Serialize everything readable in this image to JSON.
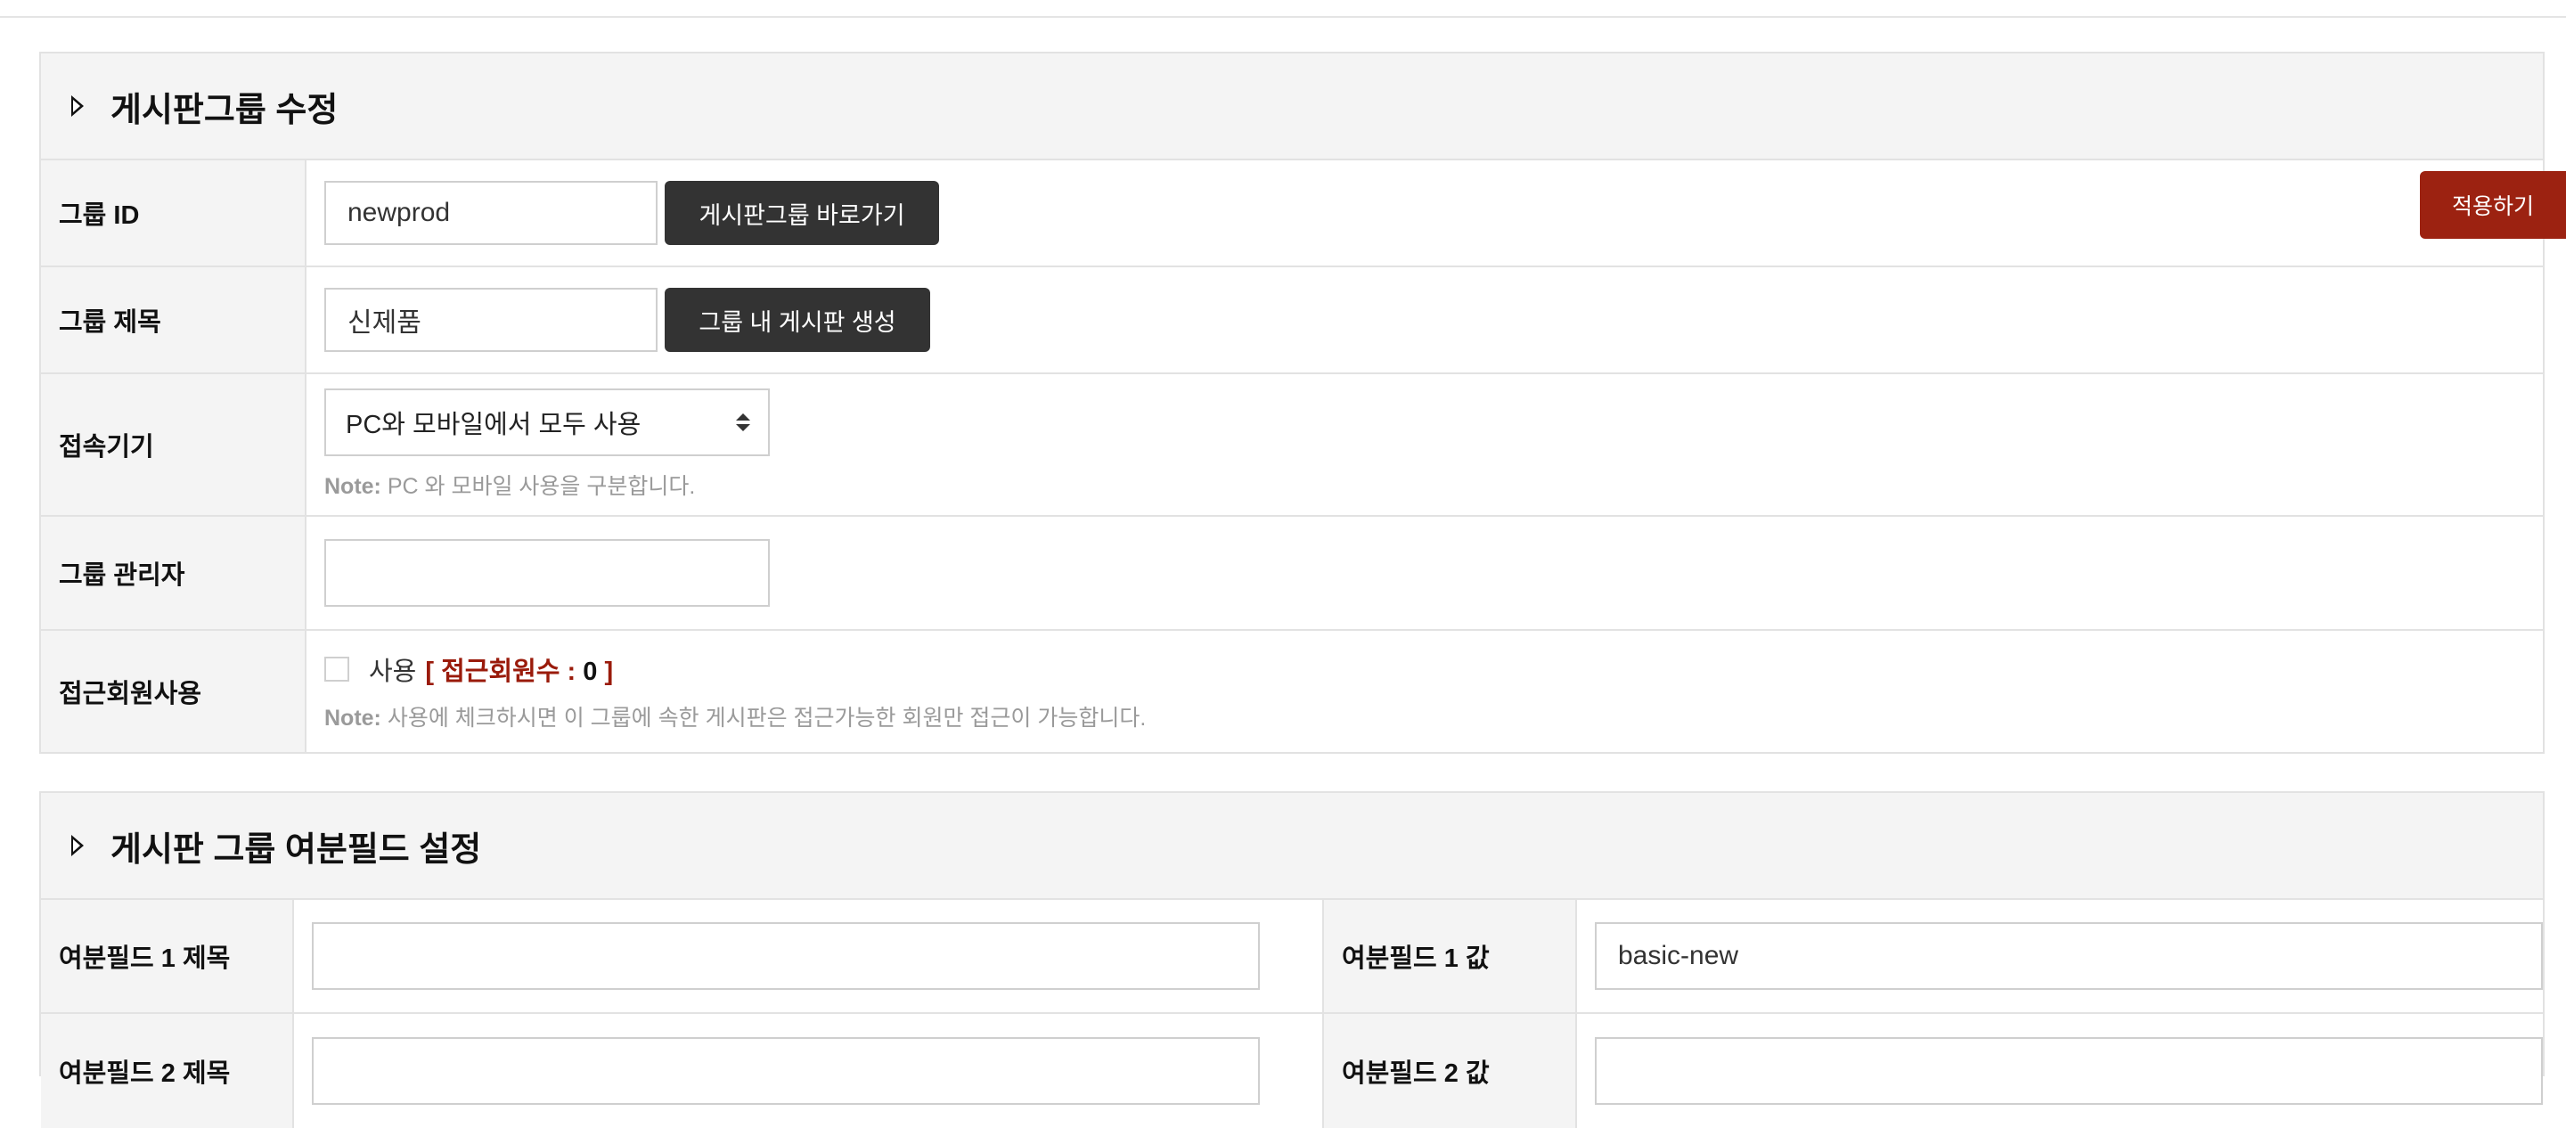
{
  "group_edit": {
    "title": "게시판그룹 수정",
    "group_id": {
      "label": "그룹 ID",
      "value": "newprod",
      "button": "게시판그룹 바로가기"
    },
    "group_title": {
      "label": "그룹 제목",
      "value": "신제품",
      "button": "그룹 내 게시판 생성"
    },
    "device": {
      "label": "접속기기",
      "selected": "PC와 모바일에서 모두 사용",
      "note_prefix": "Note:",
      "note": " PC 와 모바일 사용을 구분합니다."
    },
    "group_admin": {
      "label": "그룹 관리자",
      "value": ""
    },
    "member_access": {
      "label": "접근회원사용",
      "checkbox_label": "사용",
      "count_prefix": "[ 접근회원수 : ",
      "count": "0",
      "count_suffix": " ]",
      "checked": false,
      "note_prefix": "Note:",
      "note": " 사용에 체크하시면 이 그룹에 속한 게시판은 접근가능한 회원만 접근이 가능합니다."
    }
  },
  "apply_button": "적용하기",
  "extra_fields": {
    "title": "게시판 그룹 여분필드 설정",
    "rows": [
      {
        "title_label": "여분필드 1 제목",
        "title_value": "",
        "value_label": "여분필드 1 값",
        "value_value": "basic-new"
      },
      {
        "title_label": "여분필드 2 제목",
        "title_value": "",
        "value_label": "여분필드 2 값",
        "value_value": ""
      }
    ]
  },
  "colors": {
    "apply_button": "#9c2211",
    "dark_button": "#333333",
    "count_highlight": "#9a1b0b"
  }
}
